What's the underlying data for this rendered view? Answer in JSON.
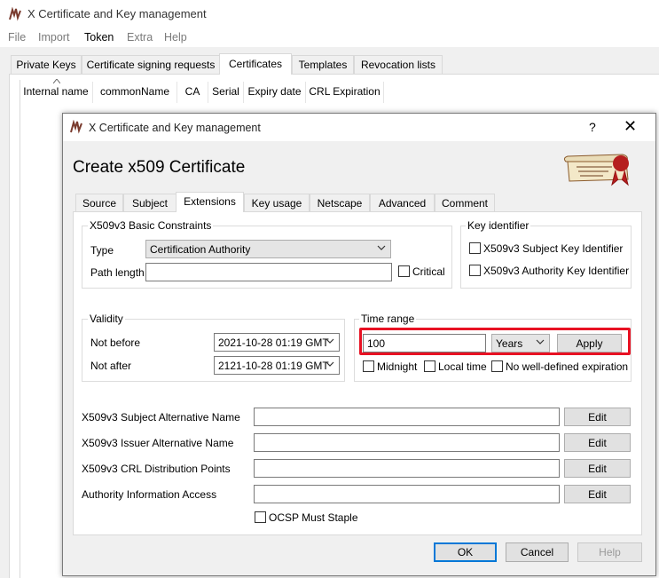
{
  "main_window": {
    "title": "X Certificate and Key management",
    "menu": [
      "File",
      "Import",
      "Token",
      "Extra",
      "Help"
    ],
    "tabs": [
      "Private Keys",
      "Certificate signing requests",
      "Certificates",
      "Templates",
      "Revocation lists"
    ],
    "columns": [
      "Internal name",
      "commonName",
      "CA",
      "Serial",
      "Expiry date",
      "CRL Expiration"
    ]
  },
  "dialog": {
    "title": "X Certificate and Key management",
    "help_glyph": "?",
    "close_glyph": "✕",
    "heading": "Create x509 Certificate",
    "tabs": [
      "Source",
      "Subject",
      "Extensions",
      "Key usage",
      "Netscape",
      "Advanced",
      "Comment"
    ],
    "basic_constraints": {
      "legend": "X509v3 Basic Constraints",
      "type_label": "Type",
      "type_value": "Certification Authority",
      "path_length_label": "Path length",
      "path_length_value": "",
      "critical_label": "Critical"
    },
    "key_identifier": {
      "legend": "Key identifier",
      "subject_key_label": "X509v3 Subject Key Identifier",
      "authority_key_label": "X509v3 Authority Key Identifier"
    },
    "validity": {
      "legend": "Validity",
      "not_before_label": "Not before",
      "not_before_value": "2021-10-28 01:19 GMT",
      "not_after_label": "Not after",
      "not_after_value": "2121-10-28 01:19 GMT"
    },
    "time_range": {
      "legend": "Time range",
      "amount": "100",
      "unit": "Years",
      "apply_label": "Apply",
      "midnight_label": "Midnight",
      "local_time_label": "Local time",
      "no_expiration_label": "No well-defined expiration"
    },
    "alt_names": [
      {
        "label": "X509v3 Subject Alternative Name",
        "value": "",
        "button": "Edit"
      },
      {
        "label": "X509v3 Issuer Alternative Name",
        "value": "",
        "button": "Edit"
      },
      {
        "label": "X509v3 CRL Distribution Points",
        "value": "",
        "button": "Edit"
      },
      {
        "label": "Authority Information Access",
        "value": "",
        "button": "Edit"
      }
    ],
    "ocsp_label": "OCSP Must Staple",
    "buttons": {
      "ok": "OK",
      "cancel": "Cancel",
      "help": "Help"
    }
  },
  "colors": {
    "highlight": "#e81123",
    "accent": "#0078d7"
  },
  "icons": [
    "app-logo-icon",
    "certificate-scroll-icon",
    "chevron-down-icon",
    "close-icon",
    "help-icon"
  ]
}
